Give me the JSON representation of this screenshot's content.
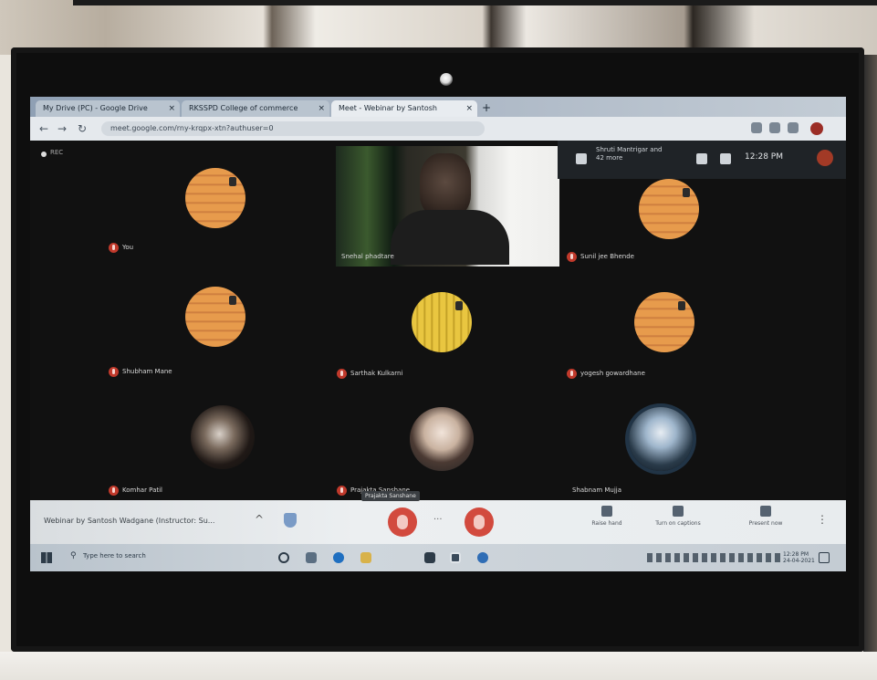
{
  "browser": {
    "tabs": [
      {
        "label": "My Drive (PC) - Google Drive"
      },
      {
        "label": "RKSSPD College of commerce"
      },
      {
        "label": "Meet - Webinar by Santosh",
        "active": true
      }
    ],
    "new_tab_label": "+",
    "close_label": "×",
    "url": "meet.google.com/rny-krqpx-xtn?authuser=0"
  },
  "meeting": {
    "rec_label": "REC",
    "side_panel_text": "Shruti Mantrigar and 42 more",
    "clock": "12:28 PM",
    "participants": [
      {
        "name": "You",
        "avatar": "orange"
      },
      {
        "name": "Snehal phadtare",
        "avatar": "video"
      },
      {
        "name": "Sunil jee Bhende",
        "avatar": "orange"
      },
      {
        "name": "Shubham Mane",
        "avatar": "orange"
      },
      {
        "name": "Sarthak Kulkarni",
        "avatar": "yellow"
      },
      {
        "name": "yogesh gowardhane",
        "avatar": "orange"
      },
      {
        "name": "Komhar Patil",
        "avatar": "photo"
      },
      {
        "name": "Prajakta Sanshane",
        "avatar": "photo"
      },
      {
        "name": "Shabnam Mujja",
        "avatar": "photo"
      }
    ],
    "presenter_tooltip": "Prajakta Sanshane"
  },
  "controls": {
    "meeting_title": "Webinar by Santosh Wadgane (Instructor: Su...",
    "chevron": "^",
    "more_dots": "···",
    "more_vert": "⋮",
    "items": [
      {
        "label": "Raise hand",
        "icon": "hand-icon"
      },
      {
        "label": "Turn on captions",
        "icon": "captions-icon"
      },
      {
        "label": "Present now",
        "icon": "present-icon"
      }
    ]
  },
  "taskbar": {
    "search_icon": "⚲",
    "search_text": "Type here to search",
    "time": "12:28 PM",
    "date": "24-04-2021"
  }
}
